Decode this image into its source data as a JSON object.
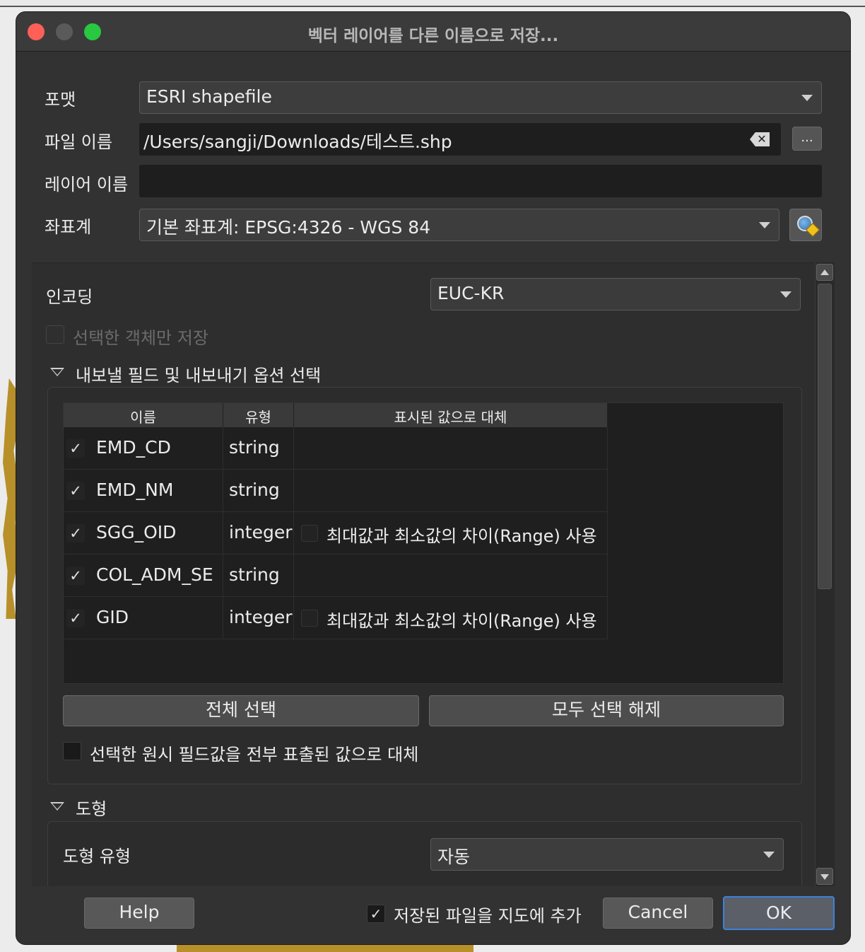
{
  "window": {
    "title": "벡터 레이어를 다른 이름으로 저장..."
  },
  "form": {
    "format_label": "포맷",
    "format_value": "ESRI shapefile",
    "filename_label": "파일 이름",
    "filename_value": "/Users/sangji/Downloads/테스트.shp",
    "browse_label": "...",
    "layername_label": "레이어 이름",
    "layername_value": "",
    "crs_label": "좌표계",
    "crs_value": "기본 좌표계: EPSG:4326 - WGS 84"
  },
  "options": {
    "encoding_label": "인코딩",
    "encoding_value": "EUC-KR",
    "selected_only_label": "선택한 객체만 저장",
    "fields_section_label": "내보낼 필드 및 내보내기 옵션 선택",
    "columns": [
      "이름",
      "유형",
      "표시된 값으로 대체"
    ],
    "fields": [
      {
        "checked": "✓",
        "name": "EMD_CD",
        "type": "string",
        "replace": ""
      },
      {
        "checked": "✓",
        "name": "EMD_NM",
        "type": "string",
        "replace": ""
      },
      {
        "checked": "✓",
        "name": "SGG_OID",
        "type": "integer",
        "replace": "최대값과 최소값의 차이(Range) 사용"
      },
      {
        "checked": "✓",
        "name": "COL_ADM_SE",
        "type": "string",
        "replace": ""
      },
      {
        "checked": "✓",
        "name": "GID",
        "type": "integer",
        "replace": "최대값과 최소값의 차이(Range) 사용"
      }
    ],
    "select_all_label": "전체 선택",
    "deselect_all_label": "모두 선택 해제",
    "replace_all_label": "선택한 원시 필드값을 전부 표출된 값으로 대체",
    "geometry_section_label": "도형",
    "geometry_type_label": "도형 유형",
    "geometry_type_value": "자동"
  },
  "footer": {
    "help_label": "Help",
    "add_to_map_check": "✓",
    "add_to_map_label": "저장된 파일을 지도에 추가",
    "cancel_label": "Cancel",
    "ok_label": "OK"
  }
}
